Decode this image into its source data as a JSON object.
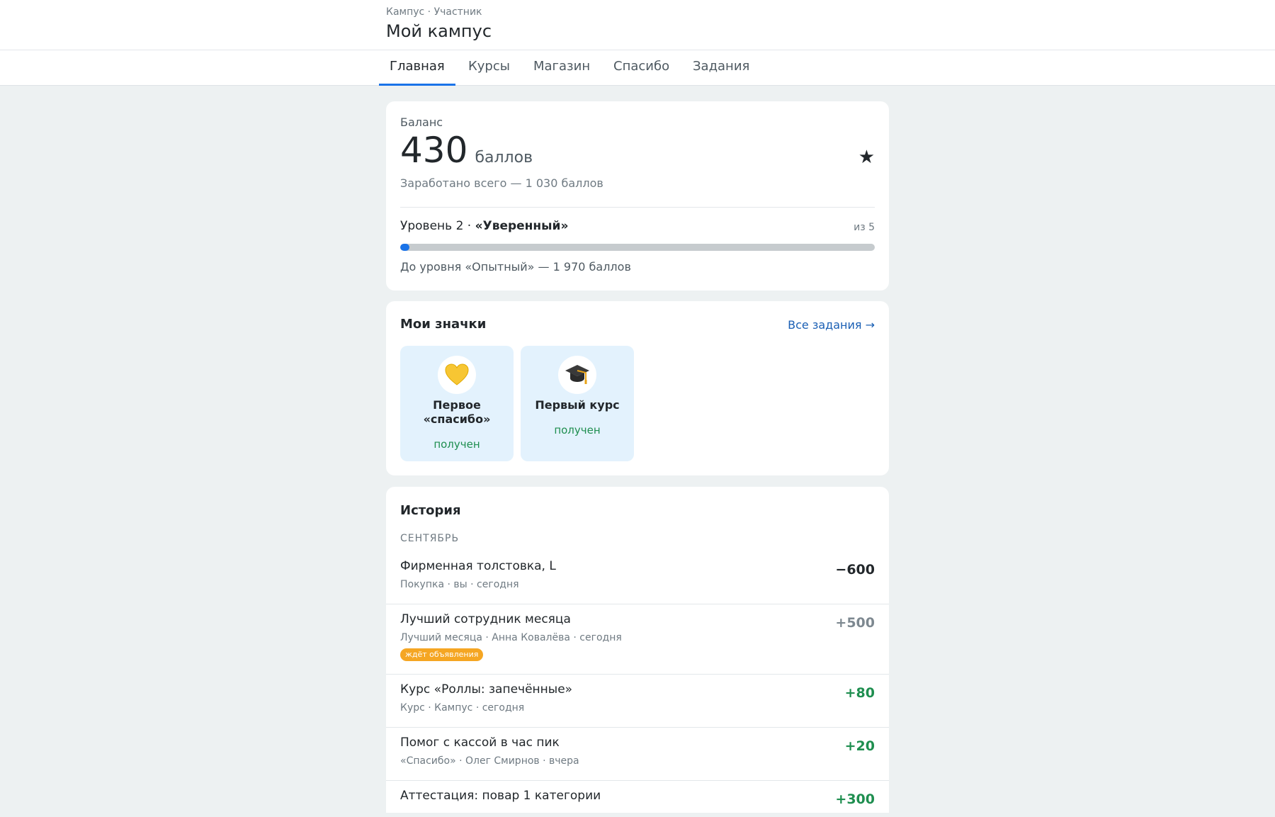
{
  "header": {
    "breadcrumb": "Кампус · Участник",
    "title": "Мой кампус"
  },
  "tabs": [
    {
      "label": "Главная",
      "active": true
    },
    {
      "label": "Курсы",
      "active": false
    },
    {
      "label": "Магазин",
      "active": false
    },
    {
      "label": "Спасибо",
      "active": false
    },
    {
      "label": "Задания",
      "active": false
    }
  ],
  "balance": {
    "label": "Баланс",
    "value": "430",
    "unit": "баллов",
    "icon": "star-icon",
    "earned_total": "Заработано всего — 1 030 баллов",
    "level_prefix": "Уровень 2 · ",
    "level_name": "«Уверенный»",
    "level_of": "из 5",
    "progress_fraction": 0.02,
    "next_level": "До уровня «Опытный» — 1 970 баллов"
  },
  "badges": {
    "title": "Мои значки",
    "all_link": "Все задания →",
    "items": [
      {
        "icon": "yellow-heart-icon",
        "name": "Первое «спасибо»",
        "status": "получен"
      },
      {
        "icon": "graduation-cap-icon",
        "name": "Первый курс",
        "status": "получен"
      }
    ]
  },
  "history": {
    "title": "История",
    "month": "СЕНТЯБРЬ",
    "entries": [
      {
        "title": "Фирменная толстовка, L",
        "meta": "Покупка · вы · сегодня",
        "amount": "−600",
        "kind": "neg"
      },
      {
        "title": "Лучший сотрудник месяца",
        "meta": "Лучший месяца · Анна Ковалёва · сегодня",
        "amount": "+500",
        "kind": "pend",
        "tag": "ждёт объявления"
      },
      {
        "title": "Курс «Роллы: запечённые»",
        "meta": "Курс · Кампус · сегодня",
        "amount": "+80",
        "kind": "pos"
      },
      {
        "title": "Помог с кассой в час пик",
        "meta": "«Спасибо» · Олег Смирнов · вчера",
        "amount": "+20",
        "kind": "pos"
      },
      {
        "title": "Аттестация: повар 1 категории",
        "meta": "",
        "amount": "+300",
        "kind": "pos"
      }
    ]
  },
  "colors": {
    "accent": "#1a73e8",
    "positive": "#1e8e4f",
    "pending": "#f5a623",
    "background": "#edf1f2"
  }
}
